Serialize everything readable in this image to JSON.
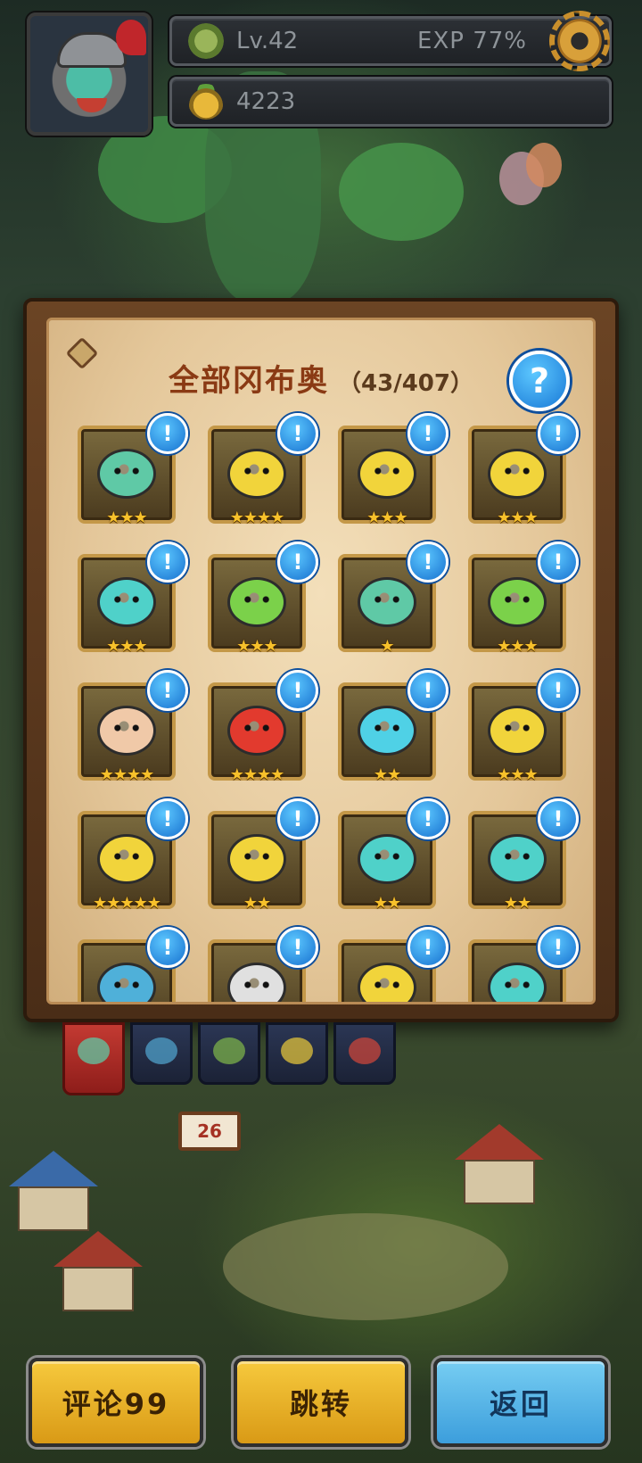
{
  "hud": {
    "level": "Lv.42",
    "exp": "EXP 77%",
    "coins": "4223",
    "icons": [
      "sprout-icon",
      "fruit-icon",
      "gear-icon"
    ]
  },
  "book": {
    "title": "全部冈布奥",
    "count": "（43/407）",
    "help_label": "?",
    "badge_label": "!"
  },
  "heroes": [
    {
      "stars": "★★★",
      "color": "#5fc9a6"
    },
    {
      "stars": "★★★★",
      "color": "#f1d43b"
    },
    {
      "stars": "★★★",
      "color": "#f1d43b"
    },
    {
      "stars": "★★★",
      "color": "#f1d43b"
    },
    {
      "stars": "★★★",
      "color": "#4fd1c9"
    },
    {
      "stars": "★★★",
      "color": "#7bd14a"
    },
    {
      "stars": "★",
      "color": "#5fc9a6"
    },
    {
      "stars": "★★★",
      "color": "#7bd14a"
    },
    {
      "stars": "★★★★",
      "color": "#f0c9a8"
    },
    {
      "stars": "★★★★",
      "color": "#e23a2e"
    },
    {
      "stars": "★★",
      "color": "#4fd1e6"
    },
    {
      "stars": "★★★",
      "color": "#f1d43b"
    },
    {
      "stars": "★★★★★",
      "color": "#f1d43b"
    },
    {
      "stars": "★★",
      "color": "#f1d43b"
    },
    {
      "stars": "★★",
      "color": "#4fd1c9"
    },
    {
      "stars": "★★",
      "color": "#4fd1c9"
    },
    {
      "stars": "",
      "color": "#4fb0d9"
    },
    {
      "stars": "",
      "color": "#e0e0e0"
    },
    {
      "stars": "",
      "color": "#f1d43b"
    },
    {
      "stars": "",
      "color": "#4fd1c9"
    }
  ],
  "stage_number": "26",
  "buttons": {
    "comments": "评论99",
    "jump": "跳转",
    "back": "返回"
  }
}
